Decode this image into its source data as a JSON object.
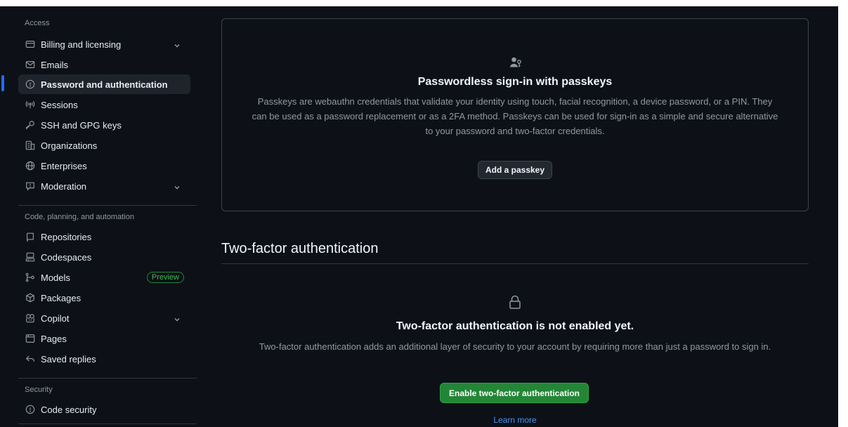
{
  "sidebar": {
    "sections": {
      "access": "Access",
      "code": "Code, planning, and automation",
      "security": "Security"
    },
    "items": [
      {
        "label": "Billing and licensing",
        "icon": "credit-card-icon",
        "expandable": true
      },
      {
        "label": "Emails",
        "icon": "mail-icon"
      },
      {
        "label": "Password and authentication",
        "icon": "shield-lock-icon",
        "active": true
      },
      {
        "label": "Sessions",
        "icon": "broadcast-icon"
      },
      {
        "label": "SSH and GPG keys",
        "icon": "key-icon"
      },
      {
        "label": "Organizations",
        "icon": "organization-icon"
      },
      {
        "label": "Enterprises",
        "icon": "globe-icon"
      },
      {
        "label": "Moderation",
        "icon": "report-icon",
        "expandable": true
      },
      {
        "label": "Repositories",
        "icon": "repo-icon"
      },
      {
        "label": "Codespaces",
        "icon": "codespaces-icon"
      },
      {
        "label": "Models",
        "icon": "models-icon",
        "badge": "Preview"
      },
      {
        "label": "Packages",
        "icon": "package-icon"
      },
      {
        "label": "Copilot",
        "icon": "copilot-icon",
        "expandable": true
      },
      {
        "label": "Pages",
        "icon": "browser-icon"
      },
      {
        "label": "Saved replies",
        "icon": "reply-icon"
      },
      {
        "label": "Code security",
        "icon": "shield-icon"
      }
    ]
  },
  "passkeys": {
    "icon": "passkey-icon",
    "title": "Passwordless sign-in with passkeys",
    "description": "Passkeys are webauthn credentials that validate your identity using touch, facial recognition, a device password, or a PIN. They can be used as a password replacement or as a 2FA method. Passkeys can be used for sign-in as a simple and secure alternative to your password and two-factor credentials.",
    "button": "Add a passkey"
  },
  "two_factor": {
    "heading": "Two-factor authentication",
    "icon": "lock-icon",
    "title": "Two-factor authentication is not enabled yet.",
    "description": "Two-factor authentication adds an additional layer of security to your account by requiring more than just a password to sign in.",
    "button": "Enable two-factor authentication",
    "link": "Learn more"
  },
  "colors": {
    "background": "#0d1117",
    "accent": "#1f6feb",
    "primary_button": "#238636",
    "link": "#4493f8"
  }
}
